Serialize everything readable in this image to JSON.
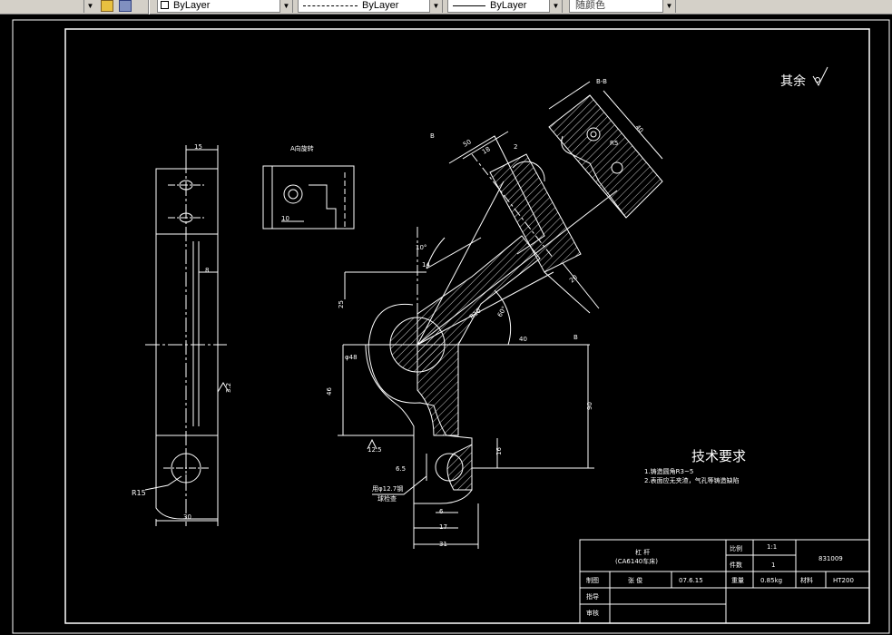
{
  "toolbar": {
    "layer_linetype": "ByLayer",
    "linetype": "ByLayer",
    "lineweight": "ByLayer",
    "color": "随颜色"
  },
  "drawing": {
    "section_label": "B-B",
    "view_label": "A向旋转",
    "surface_note": "其余",
    "tech_req_title": "技术要求",
    "tech_req_1": "1.铸造圆角R3~5",
    "tech_req_2": "2.表面应无夹渣，气孔等铸造缺陷",
    "bolt_note_1": "用φ12.7钢",
    "bolt_note_2": "球检查",
    "dims": {
      "d15": "15",
      "d8": "8",
      "d32": "3.2",
      "r15": "R15",
      "d30": "30",
      "d10": "10",
      "d46": "46",
      "d90": "90",
      "d16": "16",
      "d17": "17",
      "d31": "31",
      "d6": "6",
      "d65": "6.5",
      "d125": "12.5",
      "r10": "R10",
      "d40": "40",
      "d20": "20",
      "d18": "18",
      "d2": "2",
      "d8b": "8",
      "a10": "10°",
      "d14": "14",
      "dphi48": "φ48",
      "d25": "25",
      "r5": "R5",
      "d60": "60°",
      "d50": "50"
    },
    "cutting_b1": "B",
    "cutting_b2": "B"
  },
  "title_block": {
    "part_name": "杠  杆",
    "part_sub": "(CA6140车床)",
    "scale_label": "比例",
    "scale_value": "1:1",
    "qty_label": "件数",
    "qty_value": "1",
    "drawing_no": "831009",
    "drawn_label": "制图",
    "drawn_name": "张  俊",
    "drawn_date": "07.6.15",
    "weight_label": "重量",
    "weight_value": "0.85kg",
    "material_label": "材料",
    "material_value": "HT200",
    "guide_label": "指导",
    "review_label": "审核"
  },
  "colors": {
    "background": "#000000",
    "lines": "#ffffff",
    "toolbar": "#d4d0c8"
  }
}
